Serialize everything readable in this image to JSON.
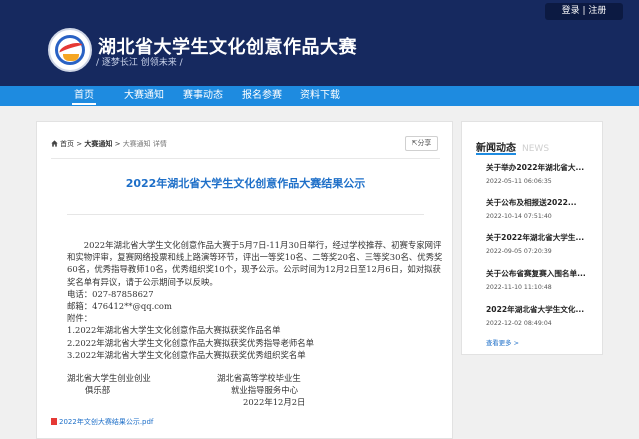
{
  "header": {
    "title": "湖北省大学生文化创意作品大赛",
    "subtitle": "/ 逐梦长江  创领未来 /",
    "auth": {
      "login": "登录",
      "separator": "|",
      "register": "注册"
    }
  },
  "nav": {
    "items": [
      {
        "label": "首页",
        "active": true
      },
      {
        "label": "大赛通知",
        "active": false
      },
      {
        "label": "赛事动态",
        "active": false
      },
      {
        "label": "报名参赛",
        "active": false
      },
      {
        "label": "资料下载",
        "active": false
      }
    ]
  },
  "breadcrumb": {
    "home": "首页",
    "sep1": ">",
    "section": "大赛通知",
    "sep2": ">",
    "current": "大赛通知 详情"
  },
  "share_label": "分享",
  "article": {
    "title": "2022年湖北省大学生文化创意作品大赛结果公示",
    "paragraph": "2022年湖北省大学生文化创意作品大赛于5月7日-11月30日举行，经过学校推荐、初赛专家网评和实物评审，复赛网络投票和线上路演等环节，评出一等奖10名、二等奖20名、三等奖30名、优秀奖60名，优秀指导教师10名，优秀组织奖10个，现予公示。公示时间为12月2日至12月6日，如对拟获奖名单有异议，请于公示期间予以反映。",
    "phone": "电话：027-87858627",
    "email": "邮箱：476412**@qq.com",
    "attachments_label": "附件：",
    "attachment_lines": [
      "1.2022年湖北省大学生文化创意作品大赛拟获奖作品名单",
      "2.2022年湖北省大学生文化创意作品大赛拟获奖优秀指导老师名单",
      "3.2022年湖北省大学生文化创意作品大赛拟获奖优秀组织奖名单"
    ],
    "signer_left": [
      "湖北省大学生创业创业",
      "俱乐部"
    ],
    "signer_right": [
      "湖北省高等学校毕业生",
      "就业指导服务中心",
      "2022年12月2日"
    ],
    "attachment_file": "2022年文创大赛结果公示.pdf"
  },
  "sidebar": {
    "heading": "新闻动态",
    "heading_en": "NEWS",
    "news": [
      {
        "title": "关于举办2022年湖北省大...",
        "date": "2022-05-11 06:06:35"
      },
      {
        "title": "关于公布及相报送2022...",
        "date": "2022-10-14 07:51:40"
      },
      {
        "title": "关于2022年湖北省大学生...",
        "date": "2022-09-05 07:20:39"
      },
      {
        "title": "关于公布省赛复赛入围名单...",
        "date": "2022-11-10 11:10:48"
      },
      {
        "title": "2022年湖北省大学生文化...",
        "date": "2022-12-02 08:49:04"
      }
    ],
    "more_label": "查看更多 >"
  },
  "colors": {
    "header_bg": "#16295f",
    "nav_bg": "#1e8be0",
    "link_blue": "#1e6fc8"
  }
}
